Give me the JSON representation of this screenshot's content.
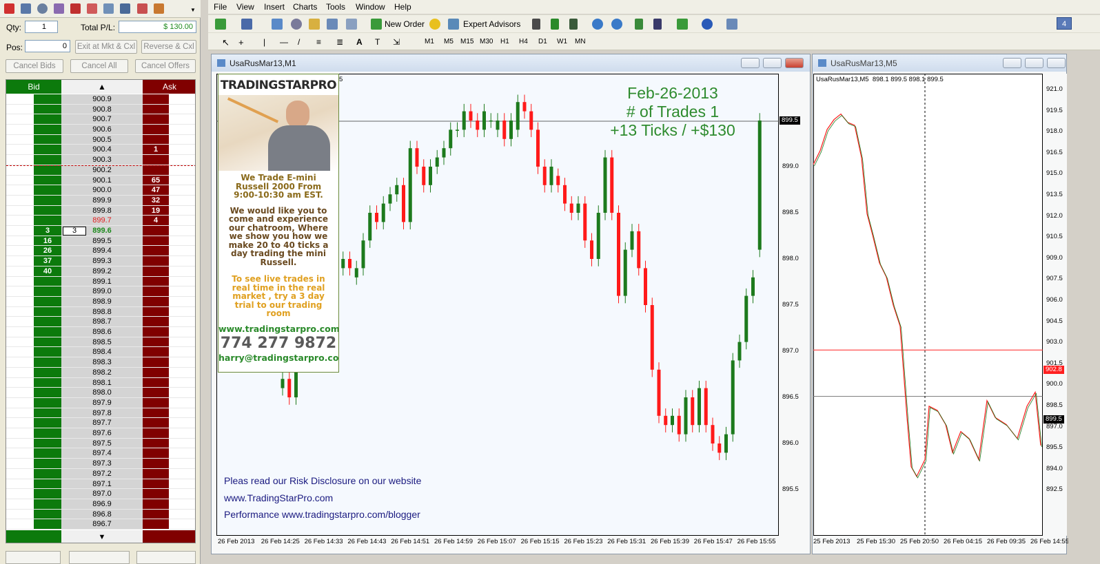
{
  "left_panel": {
    "qty_label": "Qty:",
    "qty_value": "1",
    "total_pl_label": "Total P/L:",
    "total_pl_value": "$ 130.00",
    "pos_label": "Pos:",
    "pos_value": "0",
    "btn_exit": "Exit at Mkt & Cxl",
    "btn_reverse": "Reverse & Cxl",
    "btn_cancel_bids": "Cancel Bids",
    "btn_cancel_all": "Cancel All",
    "btn_cancel_offers": "Cancel Offers",
    "bid_header": "Bid",
    "ask_header": "Ask",
    "up_arrow": "▲",
    "down_arrow": "▼",
    "rows": [
      {
        "p": "900.9"
      },
      {
        "p": "900.8"
      },
      {
        "p": "900.7"
      },
      {
        "p": "900.6"
      },
      {
        "p": "900.5"
      },
      {
        "p": "900.4",
        "ask": "1"
      },
      {
        "p": "900.3"
      },
      {
        "p": "900.2"
      },
      {
        "p": "900.1",
        "ask": "65"
      },
      {
        "p": "900.0",
        "ask": "47"
      },
      {
        "p": "899.9",
        "ask": "32"
      },
      {
        "p": "899.8",
        "ask": "19"
      },
      {
        "p": "899.7",
        "ask": "4",
        "red": true
      },
      {
        "p": "899.6",
        "bid": "3",
        "mid": "3",
        "green": true
      },
      {
        "p": "899.5",
        "bid": "16"
      },
      {
        "p": "899.4",
        "bid": "26"
      },
      {
        "p": "899.3",
        "bid": "37"
      },
      {
        "p": "899.2",
        "bid": "40"
      },
      {
        "p": "899.1"
      },
      {
        "p": "899.0"
      },
      {
        "p": "898.9"
      },
      {
        "p": "898.8"
      },
      {
        "p": "898.7"
      },
      {
        "p": "898.6"
      },
      {
        "p": "898.5"
      },
      {
        "p": "898.4"
      },
      {
        "p": "898.3"
      },
      {
        "p": "898.2"
      },
      {
        "p": "898.1"
      },
      {
        "p": "898.0"
      },
      {
        "p": "897.9"
      },
      {
        "p": "897.8"
      },
      {
        "p": "897.7"
      },
      {
        "p": "897.6"
      },
      {
        "p": "897.5"
      },
      {
        "p": "897.4"
      },
      {
        "p": "897.3"
      },
      {
        "p": "897.2"
      },
      {
        "p": "897.1"
      },
      {
        "p": "897.0"
      },
      {
        "p": "896.9"
      },
      {
        "p": "896.8"
      },
      {
        "p": "896.7"
      }
    ]
  },
  "menu": [
    "File",
    "View",
    "Insert",
    "Charts",
    "Tools",
    "Window",
    "Help"
  ],
  "toolbar": {
    "new_order": "New Order",
    "expert_advisors": "Expert Advisors",
    "corner_badge": "4",
    "timeframes": [
      "M1",
      "M5",
      "M15",
      "M30",
      "H1",
      "H4",
      "D1",
      "W1",
      "MN"
    ]
  },
  "chart1": {
    "title": "UsaRusMar13,M1",
    "header_fragment": "5",
    "overlay": [
      "Feb-26-2013",
      "# of Trades 1",
      "+13 Ticks / +$130"
    ],
    "footer": [
      "Pleas read our Risk Disclosure on our website",
      "www.TradingStarPro.com",
      "Performance www.tradingstarpro.com/blogger"
    ],
    "price_tag": "899.5",
    "yticks": [
      "899.0",
      "898.5",
      "898.0",
      "897.5",
      "897.0",
      "896.5",
      "896.0",
      "895.5"
    ],
    "xticks": [
      "26 Feb 2013",
      "26 Feb 14:25",
      "26 Feb 14:33",
      "26 Feb 14:43",
      "26 Feb 14:51",
      "26 Feb 14:59",
      "26 Feb 15:07",
      "26 Feb 15:15",
      "26 Feb 15:23",
      "26 Feb 15:31",
      "26 Feb 15:39",
      "26 Feb 15:47",
      "26 Feb 15:55"
    ]
  },
  "ad": {
    "logo": "TRADINGSTARPRO",
    "line1": "We Trade E-mini Russell 2000 From 9:00-10:30 am EST.",
    "line2": "We would like you to come and experience our chatroom, Where we show you how we make 20 to 40 ticks a day trading the mini Russell.",
    "line3": "To see live trades in real time in the real market , try a 3 day trial to our trading room",
    "website": "www.tradingstarpro.com",
    "phone": "774 277 9872",
    "email": "harry@tradingstarpro.com"
  },
  "chart2": {
    "title": "UsaRusMar13,M5",
    "header": "UsaRusMar13,M5  898.1 899.5 898.1 899.5",
    "tag_red": "902.8",
    "tag_black": "899.5",
    "yticks": [
      "921.0",
      "919.5",
      "918.0",
      "916.5",
      "915.0",
      "913.5",
      "912.0",
      "910.5",
      "909.0",
      "907.5",
      "906.0",
      "904.5",
      "903.0",
      "901.5",
      "900.0",
      "898.5",
      "897.0",
      "895.5",
      "894.0",
      "892.5"
    ],
    "xticks": [
      "25 Feb 2013",
      "25 Feb 15:30",
      "25 Feb 20:50",
      "26 Feb 04:15",
      "26 Feb 09:35",
      "26 Feb 14:55"
    ]
  },
  "colors": {
    "bull": "#1d7a1d",
    "bear": "#ff1a1a",
    "bid_bg": "#0c7a0c",
    "ask_bg": "#800000",
    "overlay_text": "#2e8b2e"
  }
}
